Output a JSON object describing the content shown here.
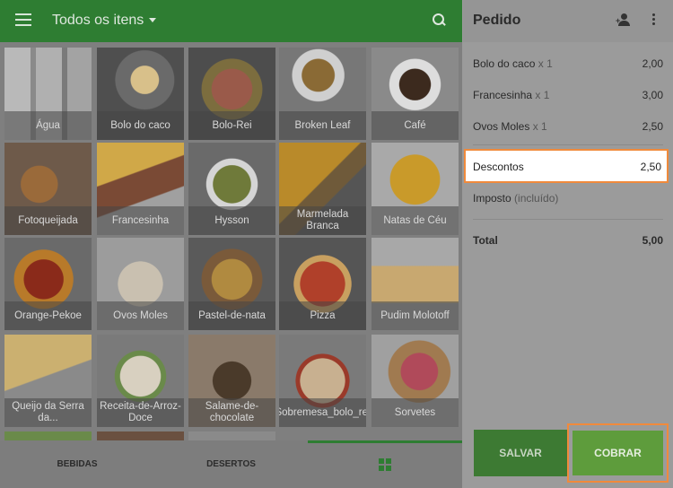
{
  "header": {
    "category_title": "Todos os itens"
  },
  "colors": {
    "primary": "#2e7d32",
    "highlight_border": "#f08a3c"
  },
  "icons": {
    "menu": "menu-icon",
    "dropdown": "caret-down-icon",
    "search": "search-icon",
    "add_customer": "person-add-icon",
    "more": "more-vert-icon",
    "grid_view": "grid-icon"
  },
  "items": [
    {
      "name": "Água"
    },
    {
      "name": "Bolo do caco"
    },
    {
      "name": "Bolo-Rei"
    },
    {
      "name": "Broken Leaf"
    },
    {
      "name": "Café"
    },
    {
      "name": "Fotoqueijada"
    },
    {
      "name": "Francesinha"
    },
    {
      "name": "Hysson"
    },
    {
      "name": "Marmelada Branca"
    },
    {
      "name": "Natas de Céu"
    },
    {
      "name": "Orange-Pekoe"
    },
    {
      "name": "Ovos Moles"
    },
    {
      "name": "Pastel-de-nata"
    },
    {
      "name": "Pizza"
    },
    {
      "name": "Pudim Molotoff"
    },
    {
      "name": "Queijo da Serra da..."
    },
    {
      "name": "Receita-de-Arroz-Doce"
    },
    {
      "name": "Salame-de-chocolate"
    },
    {
      "name": "Sobremesa_bolo_rei"
    },
    {
      "name": "Sorvetes"
    }
  ],
  "bottom_nav": {
    "tabs": [
      {
        "label": "BEBIDAS"
      },
      {
        "label": "DESERTOS"
      }
    ]
  },
  "order": {
    "title": "Pedido",
    "lines": [
      {
        "name": "Bolo do caco",
        "qty": "x 1",
        "amount": "2,00"
      },
      {
        "name": "Francesinha",
        "qty": "x 1",
        "amount": "3,00"
      },
      {
        "name": "Ovos Moles",
        "qty": "x 1",
        "amount": "2,50"
      }
    ],
    "discount": {
      "label": "Descontos",
      "amount": "2,50"
    },
    "tax": {
      "label": "Imposto",
      "note": "(incluído)"
    },
    "total": {
      "label": "Total",
      "amount": "5,00"
    },
    "save_label": "SALVAR",
    "charge_label": "COBRAR"
  }
}
